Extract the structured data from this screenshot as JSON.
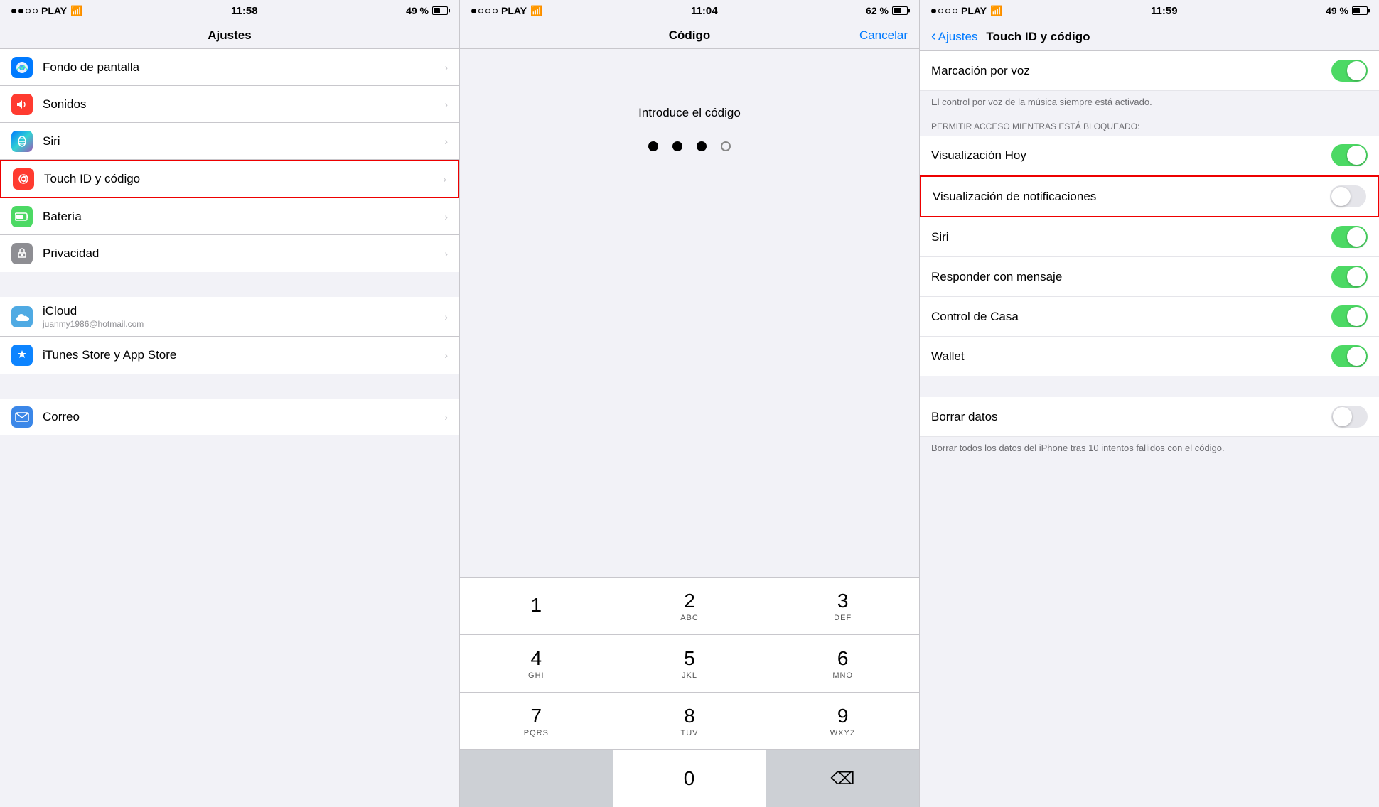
{
  "panel1": {
    "status": {
      "carrier": "PLAY",
      "time": "11:58",
      "battery": "49 %",
      "signal_full": 2,
      "signal_empty": 2
    },
    "title": "Ajustes",
    "items": [
      {
        "id": "fondo",
        "label": "Fondo de pantalla",
        "icon": "wallpaper",
        "icon_color": "blue",
        "icon_char": "✦"
      },
      {
        "id": "sonidos",
        "label": "Sonidos",
        "icon": "sound",
        "icon_color": "red",
        "icon_char": "🔔"
      },
      {
        "id": "siri",
        "label": "Siri",
        "icon": "siri",
        "icon_color": "gradient-siri",
        "icon_char": "◉"
      },
      {
        "id": "touchid",
        "label": "Touch ID y código",
        "icon": "touchid",
        "icon_color": "red",
        "icon_char": "⊛",
        "highlighted": true
      },
      {
        "id": "bateria",
        "label": "Batería",
        "icon": "battery",
        "icon_color": "green",
        "icon_char": "▮"
      },
      {
        "id": "privacidad",
        "label": "Privacidad",
        "icon": "privacy",
        "icon_color": "gray",
        "icon_char": "✋"
      }
    ],
    "section2_items": [
      {
        "id": "icloud",
        "label": "iCloud",
        "sublabel": "juanmy1986@hotmail.com",
        "icon": "icloud",
        "icon_color": "cloud-blue",
        "icon_char": "☁"
      },
      {
        "id": "itunes",
        "label": "iTunes Store y App Store",
        "icon": "appstore",
        "icon_color": "app-store",
        "icon_char": "A"
      }
    ],
    "section3_items": [
      {
        "id": "correo",
        "label": "Correo",
        "icon": "mail",
        "icon_color": "mail-blue",
        "icon_char": "✉"
      }
    ]
  },
  "panel2": {
    "status": {
      "carrier": "PLAY",
      "time": "11:04",
      "battery": "62 %",
      "signal_full": 1,
      "signal_empty": 3
    },
    "title": "Código",
    "cancel": "Cancelar",
    "prompt": "Introduce el código",
    "dots": [
      {
        "filled": true
      },
      {
        "filled": true
      },
      {
        "filled": true
      },
      {
        "filled": false
      }
    ],
    "numpad": [
      [
        {
          "number": "1",
          "letters": ""
        },
        {
          "number": "2",
          "letters": "ABC"
        },
        {
          "number": "3",
          "letters": "DEF"
        }
      ],
      [
        {
          "number": "4",
          "letters": "GHI"
        },
        {
          "number": "5",
          "letters": "JKL"
        },
        {
          "number": "6",
          "letters": "MNO"
        }
      ],
      [
        {
          "number": "7",
          "letters": "PQRS"
        },
        {
          "number": "8",
          "letters": "TUV"
        },
        {
          "number": "9",
          "letters": "WXYZ"
        }
      ],
      [
        {
          "number": "",
          "letters": "",
          "type": "empty"
        },
        {
          "number": "0",
          "letters": ""
        },
        {
          "number": "⌫",
          "letters": "",
          "type": "delete"
        }
      ]
    ]
  },
  "panel3": {
    "status": {
      "carrier": "PLAY",
      "time": "11:59",
      "battery": "49 %",
      "signal_full": 1,
      "signal_empty": 3
    },
    "back_label": "Ajustes",
    "title": "Touch ID y código",
    "items": [
      {
        "id": "marcacion",
        "label": "Marcación por voz",
        "toggle": true
      },
      {
        "id": "note1",
        "type": "note",
        "text": "El control por voz de la música siempre está activado."
      },
      {
        "id": "section_label",
        "type": "section-label",
        "text": "PERMITIR ACCESO MIENTRAS ESTÁ BLOQUEADO:"
      },
      {
        "id": "visualizacion_hoy",
        "label": "Visualización Hoy",
        "toggle": true
      },
      {
        "id": "visualizacion_notif",
        "label": "Visualización de notificaciones",
        "toggle": false,
        "highlighted": true
      },
      {
        "id": "siri",
        "label": "Siri",
        "toggle": true
      },
      {
        "id": "responder",
        "label": "Responder con mensaje",
        "toggle": true
      },
      {
        "id": "control_casa",
        "label": "Control de Casa",
        "toggle": true
      },
      {
        "id": "wallet",
        "label": "Wallet",
        "toggle": true
      },
      {
        "id": "separator",
        "type": "separator"
      },
      {
        "id": "borrar_datos",
        "label": "Borrar datos",
        "toggle": false,
        "toggle_off": true
      },
      {
        "id": "note2",
        "type": "note",
        "text": "Borrar todos los datos del iPhone tras 10 intentos fallidos con el código."
      }
    ]
  }
}
